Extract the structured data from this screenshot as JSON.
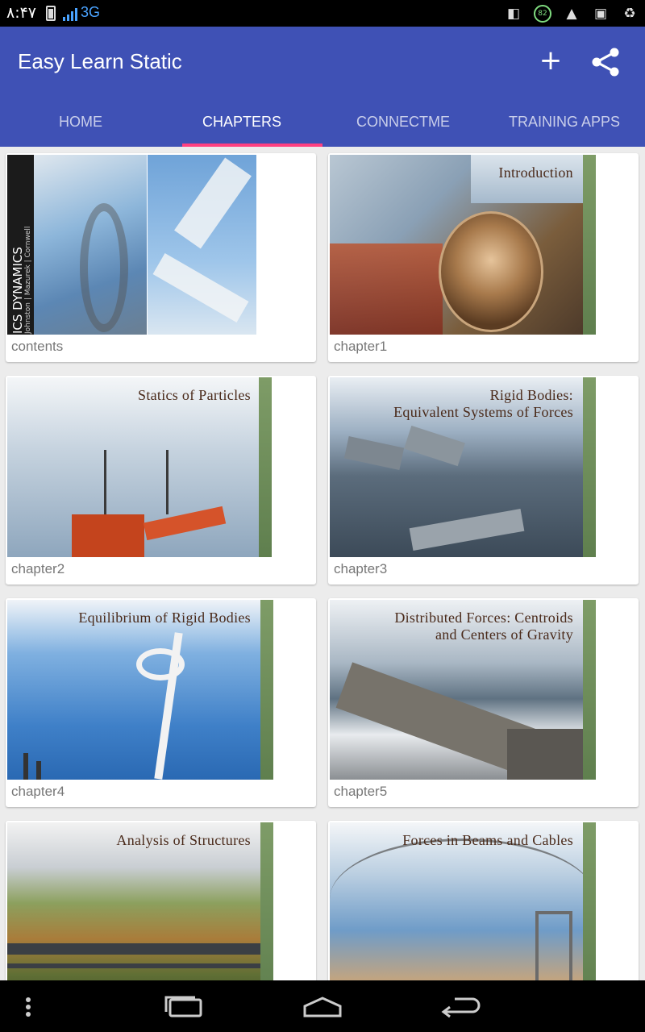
{
  "status": {
    "time": "۸:۴۷",
    "network": "3G",
    "battery_badge": "82"
  },
  "app": {
    "title": "Easy Learn Static"
  },
  "tabs": [
    {
      "label": "HOME"
    },
    {
      "label": "CHAPTERS"
    },
    {
      "label": "CONNECTME"
    },
    {
      "label": "TRAINING APPS"
    }
  ],
  "active_tab": 1,
  "cards": [
    {
      "label": "contents",
      "cover_title": "",
      "spine_title": "ICS DYNAMICS",
      "spine_authors": "Johnston | Mazurek | Cornwell"
    },
    {
      "label": "chapter1",
      "cover_title": "Introduction"
    },
    {
      "label": "chapter2",
      "cover_title": "Statics of Particles"
    },
    {
      "label": "chapter3",
      "cover_title": "Rigid Bodies:\nEquivalent Systems of Forces"
    },
    {
      "label": "chapter4",
      "cover_title": "Equilibrium of Rigid Bodies"
    },
    {
      "label": "chapter5",
      "cover_title": "Distributed Forces: Centroids\nand Centers of Gravity"
    },
    {
      "label": "",
      "cover_title": "Analysis of Structures"
    },
    {
      "label": "",
      "cover_title": "Forces in Beams and Cables"
    }
  ],
  "colors": {
    "primary": "#3f51b5",
    "accent": "#ff4081",
    "status_bar": "#000000"
  }
}
